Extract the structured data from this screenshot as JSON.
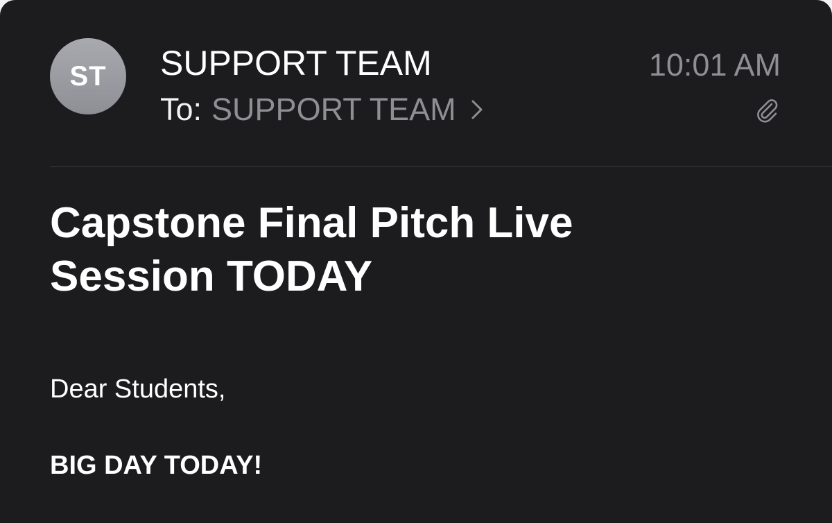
{
  "email": {
    "avatar_initials": "ST",
    "sender": "SUPPORT TEAM",
    "to_label": "To:",
    "recipient": "SUPPORT TEAM",
    "time": "10:01 AM",
    "has_attachment": true,
    "subject": "Capstone Final Pitch Live Session TODAY",
    "body": {
      "greeting": "Dear Students,",
      "headline": "BIG DAY TODAY!"
    }
  },
  "icons": {
    "recipient_chevron": "chevron-right-icon",
    "attachment": "paperclip-icon"
  },
  "colors": {
    "background": "#1c1c1e",
    "primary_text": "#ffffff",
    "secondary_text": "#8e8e93",
    "avatar": "#9a9aa1"
  }
}
